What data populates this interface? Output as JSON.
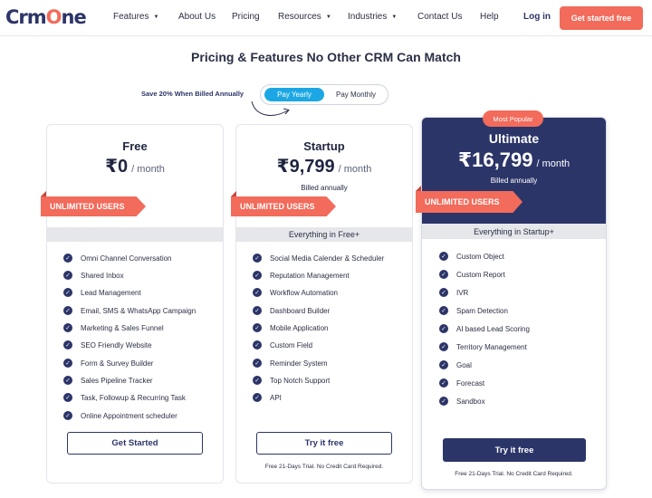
{
  "nav": {
    "logo": {
      "part1": "Crm",
      "part2": "O",
      "part3": "ne"
    },
    "items": [
      {
        "label": "Features",
        "dropdown": true
      },
      {
        "label": "About Us",
        "dropdown": false
      },
      {
        "label": "Pricing",
        "dropdown": false
      },
      {
        "label": "Resources",
        "dropdown": true
      },
      {
        "label": "Industries",
        "dropdown": true
      },
      {
        "label": "Contact Us",
        "dropdown": false
      },
      {
        "label": "Help",
        "dropdown": false
      }
    ],
    "caret": "▼",
    "login": "Log in",
    "cta": "Get started free"
  },
  "heading": "Pricing & Features No Other CRM Can Match",
  "billing": {
    "save_note": "Save 20% When Billed Annually",
    "yearly": "Pay Yearly",
    "monthly": "Pay Monthly",
    "selected": "Pay Yearly"
  },
  "check_glyph": "✓",
  "plans": [
    {
      "name": "Free",
      "price": "₹0",
      "period": "/ month",
      "billed": "",
      "ribbon": "UNLIMITED USERS",
      "everything_in": "",
      "features": [
        "Omni Channel Conversation",
        "Shared Inbox",
        "Lead Management",
        "Email, SMS & WhatsApp Campaign",
        "Marketing & Sales Funnel",
        "SEO Friendly Website",
        "Form & Survey Builder",
        "Sales Pipeline Tracker",
        "Task, Followup & Recurring Task",
        "Online Appointment scheduler"
      ],
      "button": "Get Started",
      "note": ""
    },
    {
      "name": "Startup",
      "price": "₹9,799",
      "period": "/ month",
      "billed": "Billed annually",
      "ribbon": "UNLIMITED USERS",
      "everything_in": "Everything in Free+",
      "features": [
        "Social Media Calender & Scheduler",
        "Reputation Management",
        "Workflow Automation",
        "Dashboard Builder",
        "Mobile Application",
        "Custom Field",
        "Reminder System",
        "Top Notch Support",
        "API"
      ],
      "button": "Try it free",
      "note": "Free 21-Days Trial. No Credit Card Required."
    },
    {
      "name": "Ultimate",
      "badge": "Most Popular",
      "price": "₹16,799",
      "period": "/ month",
      "billed": "Billed annually",
      "ribbon": "UNLIMITED USERS",
      "everything_in": "Everything in Startup+",
      "features": [
        "Custom Object",
        "Custom Report",
        "IVR",
        "Spam Detection",
        "AI based Lead Scoring",
        "Territory Management",
        "Goal",
        "Forecast",
        "Sandbox"
      ],
      "button": "Try it free",
      "note": "Free 21-Days Trial. No Credit Card Required."
    }
  ],
  "colors": {
    "brand_navy": "#2c3568",
    "accent_coral": "#f26b5b",
    "toggle_blue": "#1ca7e4",
    "band_gray": "#e6e7ea"
  }
}
